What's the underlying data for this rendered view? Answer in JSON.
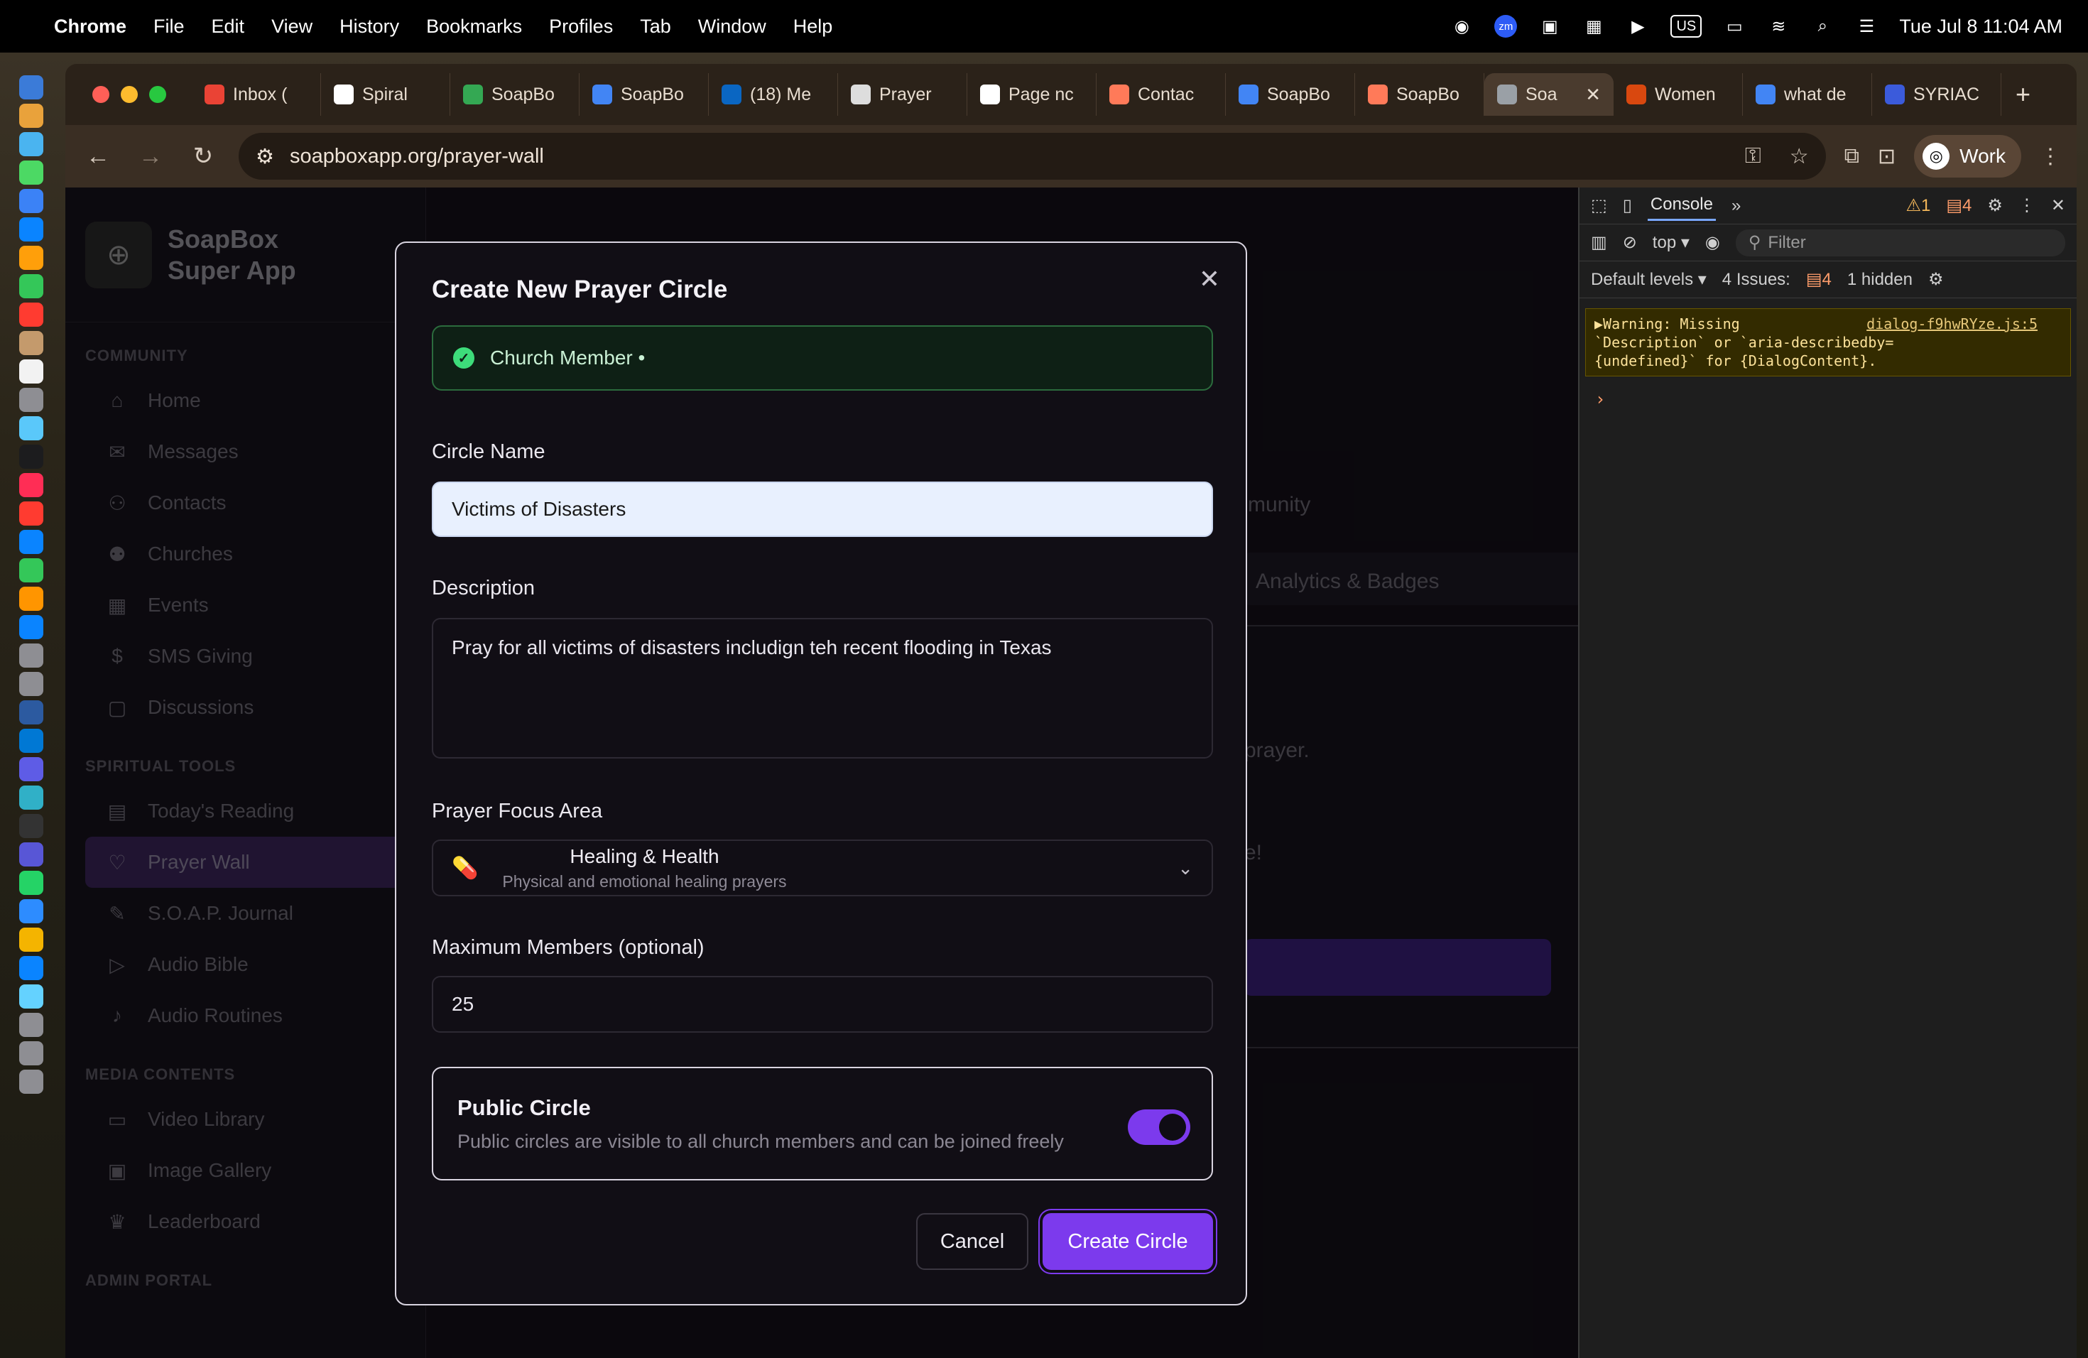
{
  "menubar": {
    "app": "Chrome",
    "items": [
      "File",
      "Edit",
      "View",
      "History",
      "Bookmarks",
      "Profiles",
      "Tab",
      "Window",
      "Help"
    ],
    "input_source": "US",
    "datetime": "Tue Jul 8  11:04 AM"
  },
  "browser": {
    "tabs": [
      {
        "label": "Inbox (",
        "color": "#ea4335"
      },
      {
        "label": "Spiral",
        "color": "#ffffff"
      },
      {
        "label": "SoapBo",
        "color": "#34a853"
      },
      {
        "label": "SoapBo",
        "color": "#4285f4"
      },
      {
        "label": "(18) Me",
        "color": "#0a66c2"
      },
      {
        "label": "Prayer",
        "color": "#dddddd"
      },
      {
        "label": "Page nc",
        "color": "#ffffff"
      },
      {
        "label": "Contac",
        "color": "#ff7a59"
      },
      {
        "label": "SoapBo",
        "color": "#4285f4"
      },
      {
        "label": "SoapBo",
        "color": "#ff7a59"
      },
      {
        "label": "Soa",
        "color": "#9aa0a6",
        "active": true
      },
      {
        "label": "Women",
        "color": "#d9480f"
      },
      {
        "label": "what de",
        "color": "#4285f4"
      },
      {
        "label": "SYRIAC",
        "color": "#3b5bdb"
      }
    ],
    "url": "soapboxapp.org/prayer-wall",
    "profile": "Work"
  },
  "sidebar": {
    "brand": "SoapBox\nSuper App",
    "logo_text": "SOAPBOX",
    "sections": [
      {
        "title": "COMMUNITY",
        "items": [
          {
            "label": "Home",
            "icon": "⌂"
          },
          {
            "label": "Messages",
            "icon": "✉"
          },
          {
            "label": "Contacts",
            "icon": "⚇"
          },
          {
            "label": "Churches",
            "icon": "⚉"
          },
          {
            "label": "Events",
            "icon": "▦"
          },
          {
            "label": "SMS Giving",
            "icon": "$"
          },
          {
            "label": "Discussions",
            "icon": "▢"
          }
        ]
      },
      {
        "title": "SPIRITUAL TOOLS",
        "items": [
          {
            "label": "Today's Reading",
            "icon": "▤"
          },
          {
            "label": "Prayer Wall",
            "icon": "♡",
            "active": true
          },
          {
            "label": "S.O.A.P. Journal",
            "icon": "✎"
          },
          {
            "label": "Audio Bible",
            "icon": "▷"
          },
          {
            "label": "Audio Routines",
            "icon": "♪"
          }
        ]
      },
      {
        "title": "MEDIA CONTENTS",
        "items": [
          {
            "label": "Video Library",
            "icon": "▭"
          },
          {
            "label": "Image Gallery",
            "icon": "▣"
          },
          {
            "label": "Leaderboard",
            "icon": "♛"
          }
        ]
      },
      {
        "title": "ADMIN PORTAL",
        "items": []
      }
    ]
  },
  "background": {
    "community_text": "mmunity",
    "tab_text": "Analytics & Badges",
    "prayer_text": "prayer.",
    "excl_text": "e!"
  },
  "modal": {
    "title": "Create New Prayer Circle",
    "role_badge": "Church Member •",
    "circle_name_label": "Circle Name",
    "circle_name_value": "Victims of Disasters",
    "description_label": "Description",
    "description_value": "Pray for all victims of disasters includign teh recent flooding in Texas",
    "focus_label": "Prayer Focus Area",
    "focus_emoji": "💊",
    "focus_title": "Healing & Health",
    "focus_subtitle": "Physical and emotional healing prayers",
    "max_label": "Maximum Members (optional)",
    "max_value": "25",
    "public_title": "Public Circle",
    "public_desc": "Public circles are visible to all church members and can be joined freely",
    "public_enabled": true,
    "cancel": "Cancel",
    "create": "Create Circle"
  },
  "devtools": {
    "tab": "Console",
    "warn_count": "1",
    "msg_count": "4",
    "context": "top",
    "filter_placeholder": "Filter",
    "levels": "Default levels",
    "issues_label": "4 Issues:",
    "issues_count": "4",
    "hidden": "1 hidden",
    "warning_lines": [
      "▶Warning: Missing",
      "`Description` or `aria-describedby=",
      "{undefined}` for {DialogContent}."
    ],
    "warning_source": "dialog-f9hwRYze.js:5",
    "prompt": "›"
  }
}
